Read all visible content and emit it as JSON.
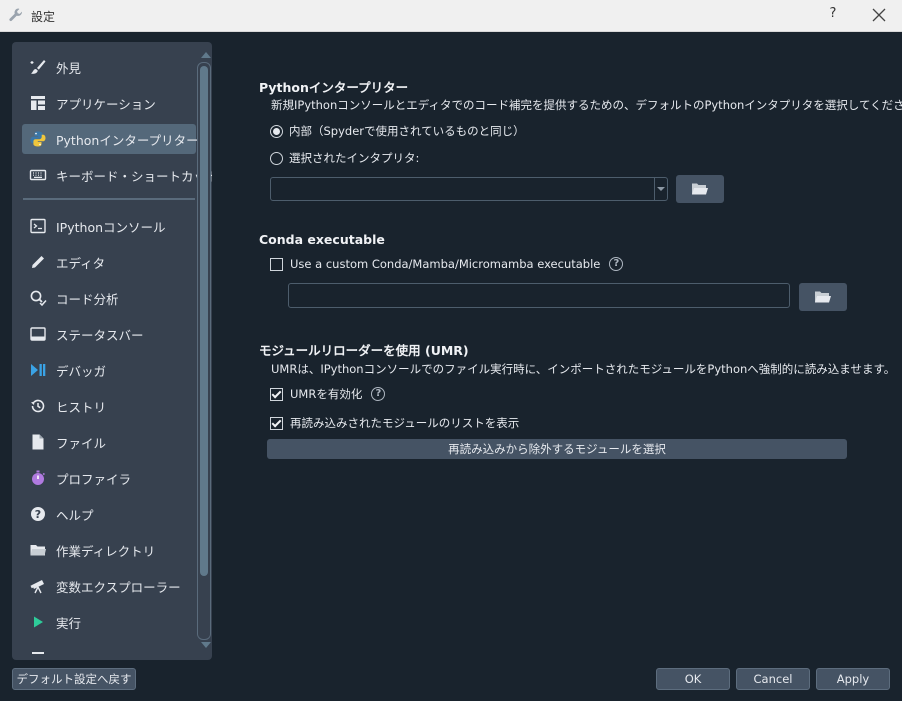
{
  "window": {
    "title": "設定",
    "help_glyph": "?",
    "close_icon": "close-icon",
    "app_icon": "wrench-icon"
  },
  "sidebar": {
    "items": [
      {
        "label": "外見",
        "icon": "paintbrush-icon"
      },
      {
        "label": "アプリケーション",
        "icon": "layout-icon"
      },
      {
        "label": "Pythonインタープリター",
        "icon": "python-icon",
        "selected": true
      },
      {
        "label": "キーボード・ショートカット",
        "icon": "keyboard-icon"
      },
      {
        "label": "IPythonコンソール",
        "icon": "terminal-icon"
      },
      {
        "label": "エディタ",
        "icon": "pencil-icon"
      },
      {
        "label": "コード分析",
        "icon": "search-check-icon"
      },
      {
        "label": "ステータスバー",
        "icon": "statusbar-icon"
      },
      {
        "label": "デバッガ",
        "icon": "debug-icon"
      },
      {
        "label": "ヒストリ",
        "icon": "history-icon"
      },
      {
        "label": "ファイル",
        "icon": "file-icon"
      },
      {
        "label": "プロファイラ",
        "icon": "stopwatch-icon"
      },
      {
        "label": "ヘルプ",
        "icon": "help-circle-icon"
      },
      {
        "label": "作業ディレクトリ",
        "icon": "folder-icon"
      },
      {
        "label": "変数エクスプローラー",
        "icon": "telescope-icon"
      },
      {
        "label": "実行",
        "icon": "run-icon"
      }
    ]
  },
  "interpreter": {
    "title": "Pythonインタープリター",
    "description": "新規IPythonコンソールとエディタでのコード補完を提供するための、デフォルトのPythonインタプリタを選択してください",
    "option_internal": "内部（Spyderで使用されているものと同じ）",
    "option_selected": "選択されたインタプリタ:",
    "selected_option": "internal",
    "path_value": ""
  },
  "conda": {
    "title": "Conda executable",
    "checkbox_label": "Use a custom Conda/Mamba/Micromamba executable",
    "checked": false,
    "path_value": ""
  },
  "umr": {
    "title": "モジュールリローダーを使用 (UMR)",
    "description": "UMRは、IPythonコンソールでのファイル実行時に、インポートされたモジュールをPythonへ強制的に読み込ませます。",
    "enable_label": "UMRを有効化",
    "enable_checked": true,
    "show_list_label": "再読み込みされたモジュールのリストを表示",
    "show_list_checked": true,
    "exclude_button": "再読み込みから除外するモジュールを選択"
  },
  "footer": {
    "reset_button": "デフォルト設定へ戻す",
    "ok_button": "OK",
    "cancel_button": "Cancel",
    "apply_button": "Apply"
  },
  "colors": {
    "background": "#19232d",
    "sidebar": "#37414f",
    "selected": "#54687a",
    "button": "#455364"
  }
}
